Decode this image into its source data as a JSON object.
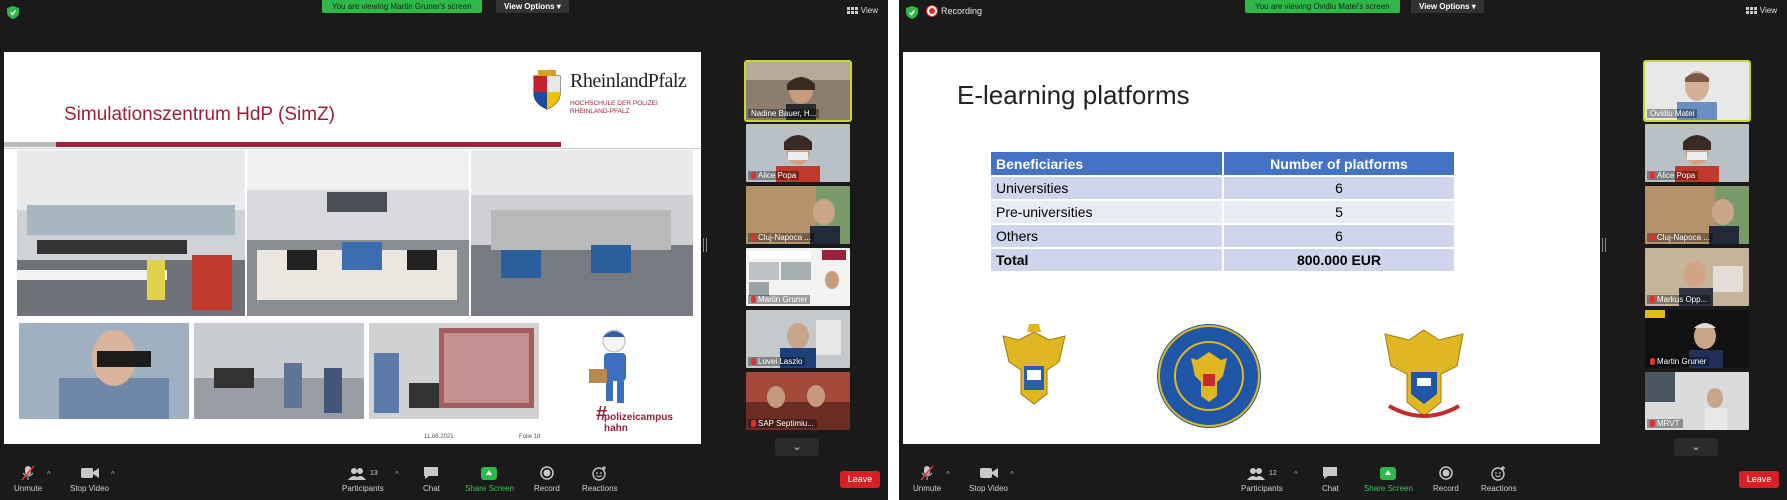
{
  "left": {
    "viewing_banner": "You are viewing Martin Gruner's screen",
    "view_options": "View Options",
    "view_label": "View",
    "slide": {
      "title": "Simulationszentrum HdP (SimZ)",
      "logo_name": "RheinlandPfalz",
      "logo_sub_1": "HOCHSCHULE DER POLIZEI",
      "logo_sub_2": "RHEINLAND-PFALZ",
      "date": "11.06.2021",
      "folie": "Folie 18",
      "campus_1": "polizeicampus",
      "campus_2": "hahn"
    },
    "participants": [
      {
        "name": "Nadine Bauer, H...",
        "active": true
      },
      {
        "name": "Alice Popa",
        "muted": true
      },
      {
        "name": "Cluj-Napoca ...",
        "muted": true
      },
      {
        "name": "Martin Gruner",
        "muted": true
      },
      {
        "name": "Lovei Laszlo",
        "muted": true
      },
      {
        "name": "SAP Septimiu...",
        "muted": true
      }
    ],
    "toolbar": {
      "unmute": "Unmute",
      "stop_video": "Stop Video",
      "participants": "Participants",
      "participants_count": "13",
      "chat": "Chat",
      "share_screen": "Share Screen",
      "record": "Record",
      "reactions": "Reactions",
      "leave": "Leave"
    }
  },
  "right": {
    "recording": "Recording",
    "viewing_banner": "You are viewing Ovidiu Matei's screen",
    "view_options": "View Options",
    "view_label": "View",
    "slide": {
      "title": "E-learning platforms",
      "table": {
        "headers": [
          "Beneficiaries",
          "Number of platforms"
        ],
        "rows": [
          [
            "Universities",
            "6"
          ],
          [
            "Pre-universities",
            "5"
          ],
          [
            "Others",
            "6"
          ]
        ],
        "total": [
          "Total",
          "800.000 EUR"
        ]
      }
    },
    "participants": [
      {
        "name": "Ovidiu Matei",
        "active": true
      },
      {
        "name": "Alice Popa",
        "muted": true
      },
      {
        "name": "Cluj-Napoca ...",
        "muted": true
      },
      {
        "name": "Markus Opp...",
        "muted": true
      },
      {
        "name": "Martin Gruner",
        "muted": true
      },
      {
        "name": "MRVT",
        "muted": true
      }
    ],
    "toolbar": {
      "unmute": "Unmute",
      "stop_video": "Stop Video",
      "participants": "Participants",
      "participants_count": "12",
      "chat": "Chat",
      "share_screen": "Share Screen",
      "record": "Record",
      "reactions": "Reactions",
      "leave": "Leave"
    }
  }
}
